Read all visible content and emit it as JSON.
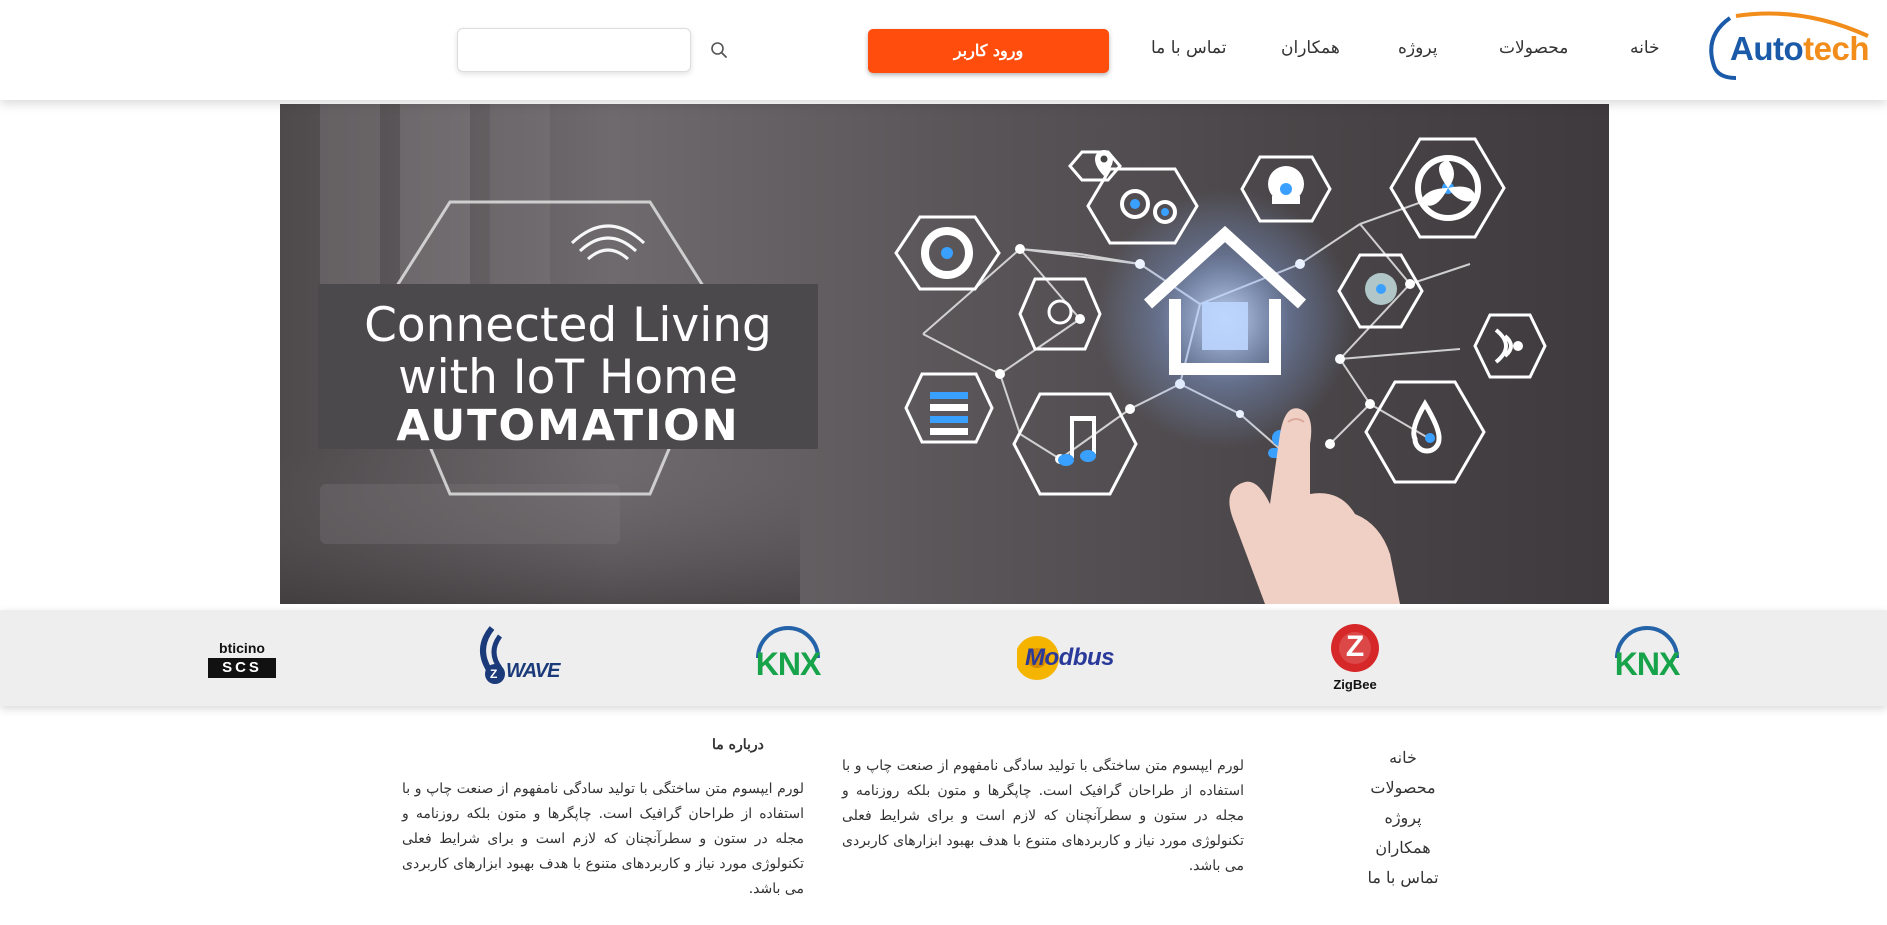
{
  "header": {
    "logo_text_part1": "Auto",
    "logo_text_part2": "tech",
    "nav": [
      {
        "label": "خانه"
      },
      {
        "label": "محصولات"
      },
      {
        "label": "پروژه"
      },
      {
        "label": "همکاران"
      },
      {
        "label": "تماس با ما"
      }
    ],
    "login_label": "ورود کاربر",
    "search": {
      "placeholder": "",
      "value": ""
    }
  },
  "banner": {
    "line1": "Connected Living",
    "line2": "with IoT Home",
    "line3": "AUTOMATION"
  },
  "partners": [
    {
      "name": "bticino",
      "label_top": "bticino",
      "label_bottom": "SCS"
    },
    {
      "name": "zwave",
      "label": "WAVE",
      "badge": "Z"
    },
    {
      "name": "knx",
      "label": "KNX"
    },
    {
      "name": "modbus",
      "label": "Modbus"
    },
    {
      "name": "zigbee",
      "label": "ZigBee",
      "badge": "Z"
    },
    {
      "name": "knx",
      "label": "KNX"
    }
  ],
  "footer": {
    "links": [
      {
        "label": "خانه"
      },
      {
        "label": "محصولات"
      },
      {
        "label": "پروژه"
      },
      {
        "label": "همکاران"
      },
      {
        "label": "تماس با ما"
      }
    ],
    "middle_text": "لورم ایپسوم متن ساختگی با تولید سادگی نامفهوم از صنعت چاپ و با استفاده از طراحان گرافیک است. چاپگرها و متون بلکه روزنامه و مجله در ستون و سطرآنچنان که لازم است و برای شرایط فعلی تکنولوژی مورد نیاز و کاربردهای متنوع با هدف بهبود ابزارهای کاربردی می باشد.",
    "about": {
      "heading": "درباره ما",
      "text": "لورم ایپسوم متن ساختگی با تولید سادگی نامفهوم از صنعت چاپ و با استفاده از طراحان گرافیک است. چاپگرها و متون بلکه روزنامه و مجله در ستون و سطرآنچنان که لازم است و برای شرایط فعلی تکنولوژی مورد نیاز و کاربردهای متنوع با هدف بهبود ابزارهای کاربردی می باشد."
    }
  },
  "colors": {
    "accent": "#ff4d0d",
    "logo_blue": "#1a5aa8",
    "logo_orange": "#f28c1a",
    "partner_bar": "#eeeeee",
    "knx_green": "#16a34a"
  }
}
